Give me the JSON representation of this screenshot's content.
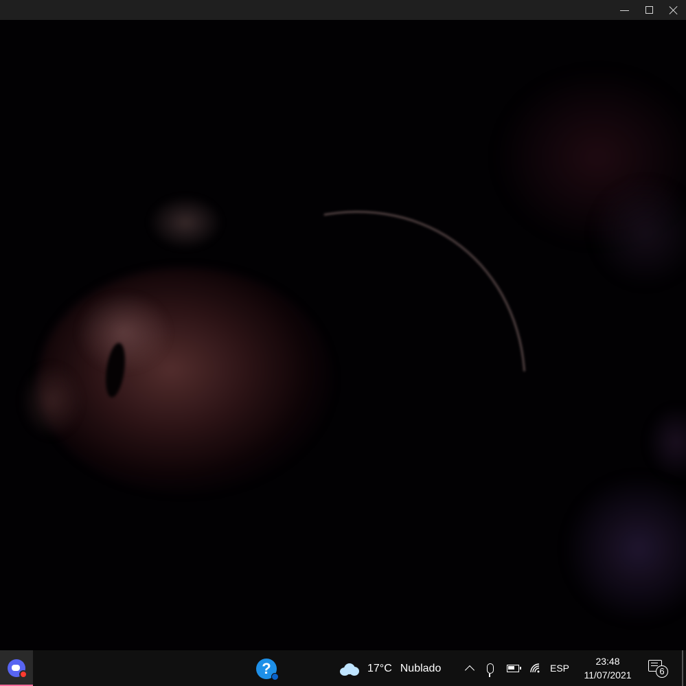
{
  "window_controls": {
    "minimize_icon": "minimize-icon",
    "maximize_icon": "maximize-icon",
    "close_icon": "close-icon"
  },
  "camera_view": {
    "description_visible": false
  },
  "taskbar": {
    "pinned_app_icon": "controller-record-app-icon",
    "pinned_app_accent": "#ff6b9a",
    "help_icon": "help-icon",
    "help_icon_color": "#1e90e8",
    "weather": {
      "icon": "cloud-icon",
      "temperature": "17°C",
      "condition": "Nublado"
    },
    "tray": {
      "show_hidden_icon": "chevron-up-icon",
      "mic_icon": "microphone-icon",
      "battery_icon": "battery-icon",
      "wifi_icon": "wifi-icon",
      "language": "ESP"
    },
    "clock": {
      "time": "23:48",
      "date": "11/07/2021"
    },
    "notifications": {
      "icon": "notification-center-icon",
      "count": "6"
    }
  }
}
